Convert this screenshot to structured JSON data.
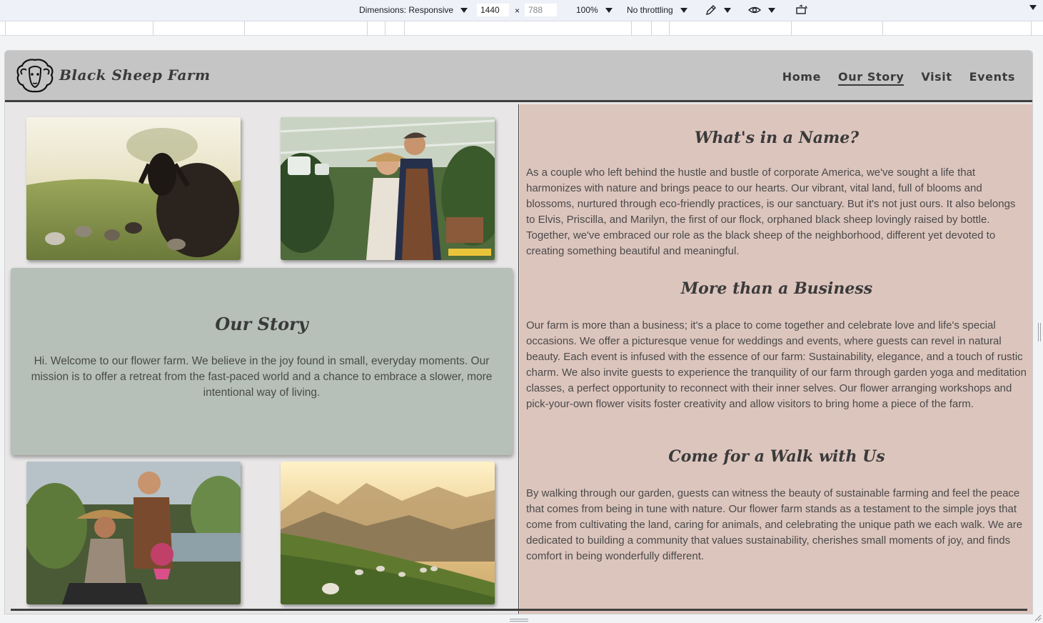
{
  "devtools": {
    "dimensions_label": "Dimensions: Responsive",
    "width_value": "1440",
    "height_value": "788",
    "times_sign": "×",
    "zoom_label": "100%",
    "throttling_label": "No throttling"
  },
  "site": {
    "brand": "Black Sheep Farm",
    "nav": [
      "Home",
      "Our Story",
      "Visit",
      "Events"
    ],
    "active_nav": "Our Story"
  },
  "story": {
    "title": "Our Story",
    "text": "Hi. Welcome to our flower farm. We believe in the joy found in small, everyday moments. Our mission is to offer a retreat from the fast-paced world and a chance to embrace a slower, more intentional way of living."
  },
  "sections": [
    {
      "title": "What's in a Name?",
      "text": "As a couple who left behind the hustle and bustle of corporate America, we've sought a life that harmonizes with nature and brings peace to our hearts. Our vibrant, vital land, full of blooms and blossoms, nurtured through eco-friendly practices, is our sanctuary. But it's not just ours. It also belongs to Elvis, Priscilla, and Marilyn, the first of our flock, orphaned black sheep lovingly raised by bottle. Together, we've embraced our role as the black sheep of the neighborhood, different yet devoted to creating something beautiful and meaningful."
    },
    {
      "title": "More than a Business",
      "text": "Our farm is more than a business; it's a place to come together and celebrate love and life's special occasions. We offer a picturesque venue for weddings and events, where guests can revel in natural beauty. Each event is infused with the essence of our farm: Sustainability, elegance, and a touch of rustic charm. We also invite guests to experience the tranquility of our farm through garden yoga and meditation classes, a perfect opportunity to reconnect with their inner selves. Our flower arranging workshops and pick-your-own flower visits foster creativity and allow visitors to bring home a piece of the farm."
    },
    {
      "title": "Come for a Walk with Us",
      "text": "By walking through our garden, guests can witness the beauty of sustainable farming and feel the peace that comes from being in tune with nature. Our flower farm stands as a testament to the simple joys that come from cultivating the land, caring for animals, and celebrating the unique path we each walk. We are dedicated to building a community that values sustainability, cherishes small moments of joy, and finds comfort in being wonderfully different."
    }
  ],
  "icons": {
    "logo": "sheep-head-icon",
    "eyedropper": "eyedropper-icon",
    "vision": "eye-icon",
    "rotate": "rotate-device-icon"
  },
  "colors": {
    "navbar": "#c5c5c5",
    "story_panel": "#b6c0b9",
    "right_panel": "#dcc5bd",
    "text": "#3a3a3a"
  }
}
